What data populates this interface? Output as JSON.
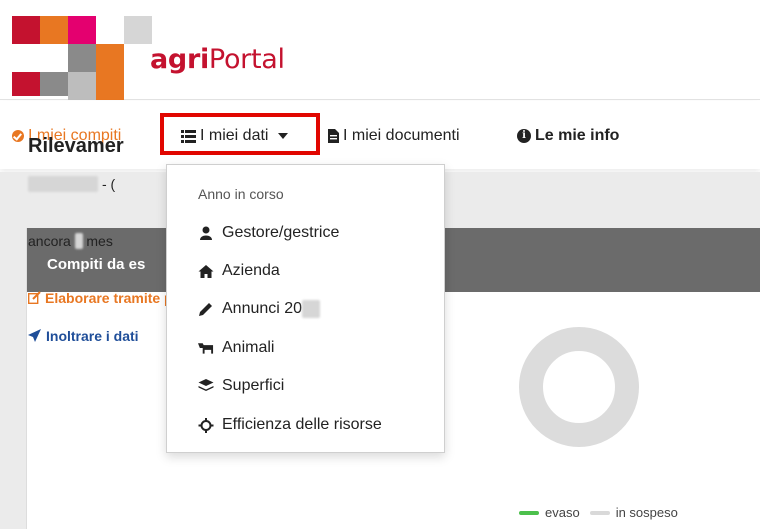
{
  "header": {
    "brand_bold": "agri",
    "brand_rest": "Portal",
    "logo_colors": [
      "#c4122f",
      "#e87722",
      "#e4006f",
      "#8a8a8a",
      "#bdbdbd"
    ]
  },
  "nav": {
    "compiti": "I miei compiti",
    "dati": "I miei dati",
    "documenti": "I miei documenti",
    "info": "Le mie info"
  },
  "dropdown": {
    "header": "Anno in corso",
    "items": [
      {
        "label": "Gestore/gestrice",
        "icon": "user-icon"
      },
      {
        "label": "Azienda",
        "icon": "home-icon"
      },
      {
        "label": "Annunci 20",
        "icon": "pencil-icon"
      },
      {
        "label": "Animali",
        "icon": "cow-icon"
      },
      {
        "label": "Superfici",
        "icon": "layers-icon"
      },
      {
        "label": "Efficienza delle risorse",
        "icon": "crosshair-icon"
      }
    ]
  },
  "card": {
    "header": "Compiti da es",
    "title": "Rilevamer",
    "date_suffix": " - (",
    "ancora_prefix": "ancora ",
    "ancora_suffix": " mes",
    "link_guided": "Elaborare tramite procedura guidata",
    "link_forward": "Inoltrare i dati"
  },
  "legend": {
    "done": "evaso",
    "pending": "in sospeso",
    "done_color": "#4cc04c",
    "pending_color": "#d9d9d9"
  },
  "colors": {
    "accent_orange": "#e87722",
    "highlight_red": "#e10600",
    "link_blue": "#1f4e99",
    "card_header": "#6b6b6b"
  }
}
